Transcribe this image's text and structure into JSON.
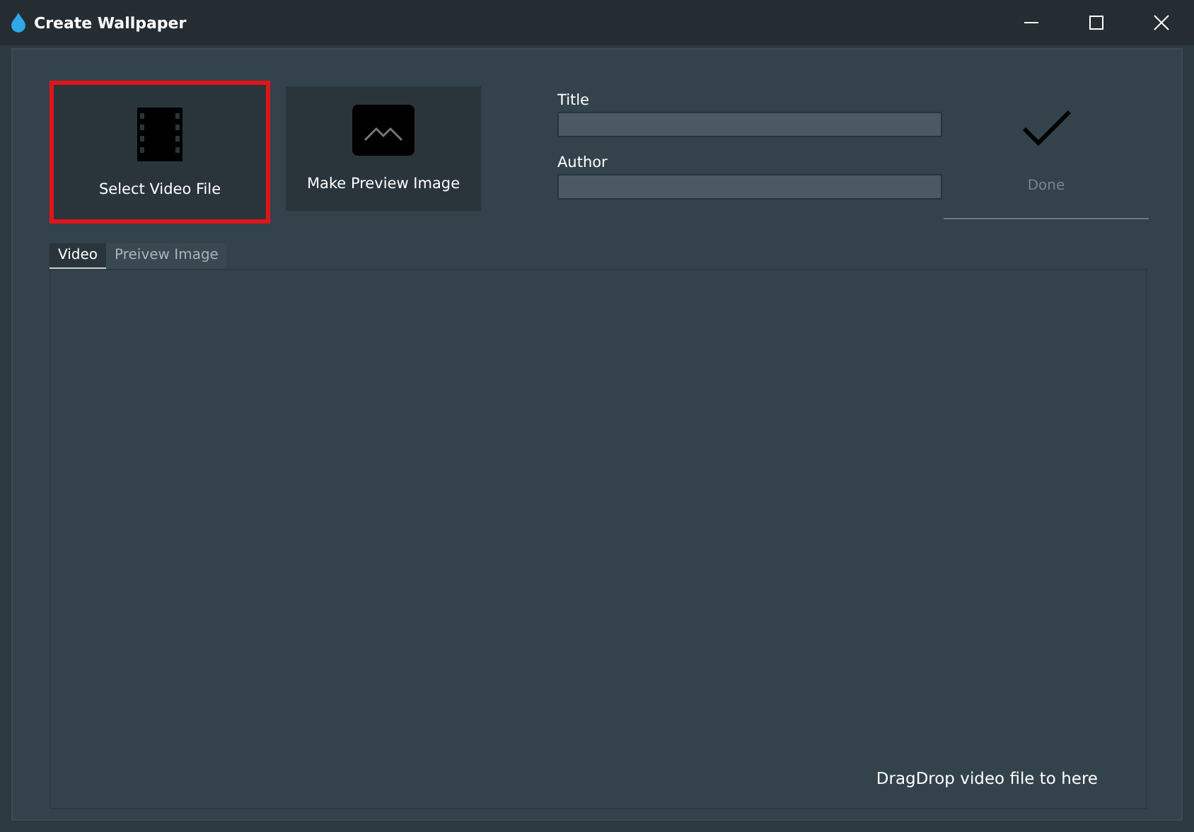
{
  "window": {
    "title": "Create Wallpaper"
  },
  "actions": [
    {
      "label": "Select Video File",
      "kind": "video",
      "selected": true
    },
    {
      "label": "Make Preview Image",
      "kind": "image",
      "selected": false
    }
  ],
  "fields": [
    {
      "label": "Title"
    },
    {
      "label": "Author"
    }
  ],
  "done": {
    "label": "Done",
    "disabled": true
  },
  "tabs": [
    {
      "label": "Video",
      "selected": true
    },
    {
      "label": "Preivew Image",
      "selected": false
    }
  ],
  "drop_hint": "DragDrop video file to here"
}
